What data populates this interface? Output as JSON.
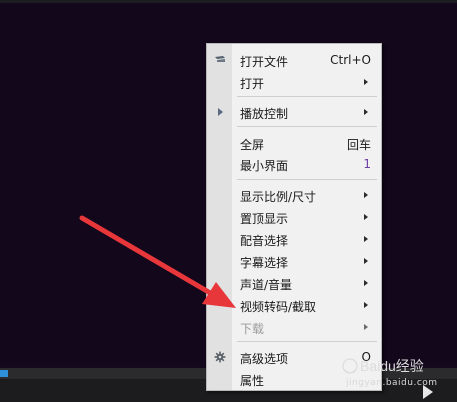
{
  "menu": {
    "items": [
      {
        "label": "打开文件",
        "shortcut": "Ctrl+O",
        "submenu": false,
        "icon": "open-file-icon"
      },
      {
        "label": "打开",
        "shortcut": "",
        "submenu": true
      },
      {
        "label": "播放控制",
        "shortcut": "",
        "submenu": true,
        "icon": "play-control-icon"
      },
      {
        "label": "全屏",
        "shortcut": "回车",
        "submenu": false
      },
      {
        "label": "最小界面",
        "shortcut": "1",
        "submenu": false
      },
      {
        "label": "显示比例/尺寸",
        "shortcut": "",
        "submenu": true
      },
      {
        "label": "置顶显示",
        "shortcut": "",
        "submenu": true
      },
      {
        "label": "配音选择",
        "shortcut": "",
        "submenu": true
      },
      {
        "label": "字幕选择",
        "shortcut": "",
        "submenu": true
      },
      {
        "label": "声道/音量",
        "shortcut": "",
        "submenu": true
      },
      {
        "label": "视频转码/截取",
        "shortcut": "",
        "submenu": true
      },
      {
        "label": "下载",
        "shortcut": "",
        "submenu": true,
        "disabled": true
      },
      {
        "label": "高级选项",
        "shortcut": "O",
        "submenu": false,
        "icon": "gear-icon"
      },
      {
        "label": "属性",
        "shortcut": "",
        "submenu": false
      }
    ]
  },
  "annotation": {
    "arrow_color": "#e8373a"
  },
  "watermark": {
    "text": "Baidu经验",
    "url_text": "jingyan.baidu.com"
  },
  "colors": {
    "progress": "#2d8fd9",
    "background": "#12071b",
    "menu": "#f1f1f1"
  }
}
